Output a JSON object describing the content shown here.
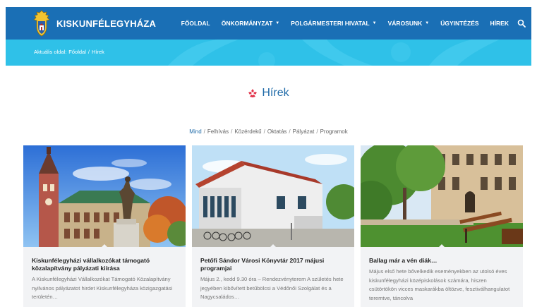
{
  "header": {
    "site_name": "KISKUNFÉLEGYHÁZA",
    "nav": [
      {
        "label": "FŐOLDAL",
        "has_dropdown": false
      },
      {
        "label": "ÖNKORMÁNYZAT",
        "has_dropdown": true
      },
      {
        "label": "POLGÁRMESTERI HIVATAL",
        "has_dropdown": true
      },
      {
        "label": "VÁROSUNK",
        "has_dropdown": true
      },
      {
        "label": "ÜGYINTÉZÉS",
        "has_dropdown": false
      },
      {
        "label": "HÍREK",
        "has_dropdown": false
      }
    ],
    "search_icon": "search-icon",
    "colors": {
      "primary": "#1a6fb5",
      "secondary": "#2fc1e8"
    }
  },
  "breadcrumb": {
    "prefix": "Aktuális oldal:",
    "items": [
      "Főoldal",
      "Hírek"
    ],
    "separator": "/"
  },
  "page": {
    "title": "Hírek",
    "title_icon": "flower-icon",
    "title_color": "#1f6aa8",
    "icon_color": "#e2324a"
  },
  "filters": {
    "items": [
      "Mind",
      "Felhívás",
      "Közérdekű",
      "Oktatás",
      "Pályázat",
      "Programok"
    ],
    "active": "Mind",
    "separator": "/"
  },
  "cards": [
    {
      "title": "Kiskunfélegyházi vállalkozókat támogató közalapítvány pályázati kiírása",
      "excerpt": "A Kiskunfélegyházi Vállalkozókat Támogató Közalapítvány nyilvános pályázatot hirdet Kiskunfélegyháza közigazgatási területén…"
    },
    {
      "title": "Petőfi Sándor Városi Könyvtár 2017 májusi programjai",
      "excerpt": "Május 2., kedd 9.30 óra – Rendezvényterem A születés hete jegyében kibővített betűbölcsi a Védőnői Szolgálat és a Nagycsaládos…"
    },
    {
      "title": "Ballag már a vén diák…",
      "excerpt": "Május első hete bővelkedik eseményekben az utolsó éves kiskunfélegyházi középiskolások számára, hiszen csütörtökön vicces maskarákba öltözve, fesztiválhangulatot teremtve, táncolva"
    }
  ]
}
